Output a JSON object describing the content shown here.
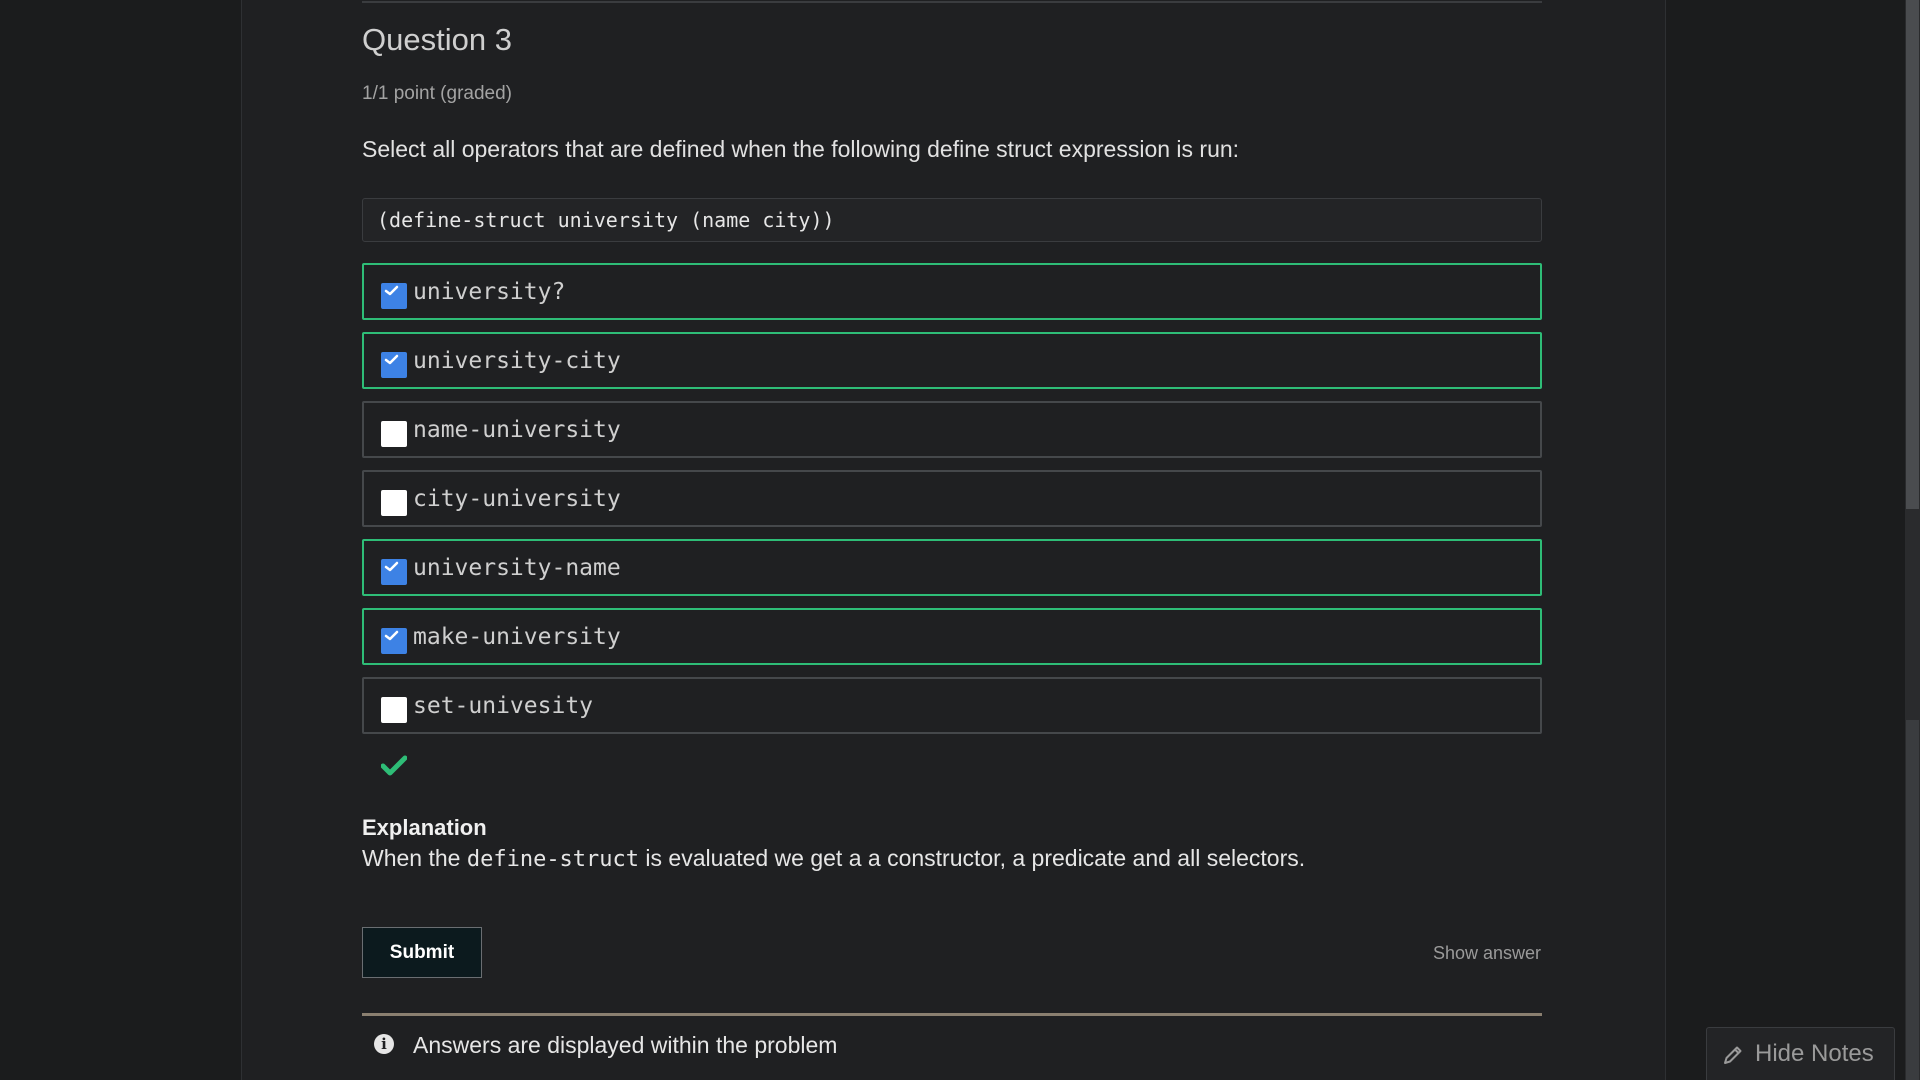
{
  "question": {
    "title": "Question 3",
    "points": "1/1 point (graded)",
    "prompt": "Select all operators that are defined when the following define struct expression is run:",
    "code": "(define-struct university (name city))"
  },
  "choices": [
    {
      "label": "university?",
      "checked": true,
      "correct": true
    },
    {
      "label": "university-city",
      "checked": true,
      "correct": true
    },
    {
      "label": "name-university",
      "checked": false,
      "correct": false
    },
    {
      "label": "city-university",
      "checked": false,
      "correct": false
    },
    {
      "label": "university-name",
      "checked": true,
      "correct": true
    },
    {
      "label": "make-university",
      "checked": true,
      "correct": true
    },
    {
      "label": "set-univesity",
      "checked": false,
      "correct": false
    }
  ],
  "result": {
    "icon": "checkmark-icon",
    "color": "#2ebd77"
  },
  "explanation": {
    "heading": "Explanation",
    "text_before": "When the ",
    "code": "define-struct",
    "text_after": " is evaluated we get a a constructor, a predicate and all selectors."
  },
  "actions": {
    "submit_label": "Submit",
    "show_answer_label": "Show answer"
  },
  "notice": {
    "icon": "info-icon",
    "text": "Answers are displayed within the problem"
  },
  "notes": {
    "icon": "pencil-icon",
    "label": "Hide Notes"
  },
  "colors": {
    "background": "#1b1c1d",
    "panel": "#1f2022",
    "correct_border": "#2ebd77",
    "checkbox_checked": "#3d82e5"
  }
}
